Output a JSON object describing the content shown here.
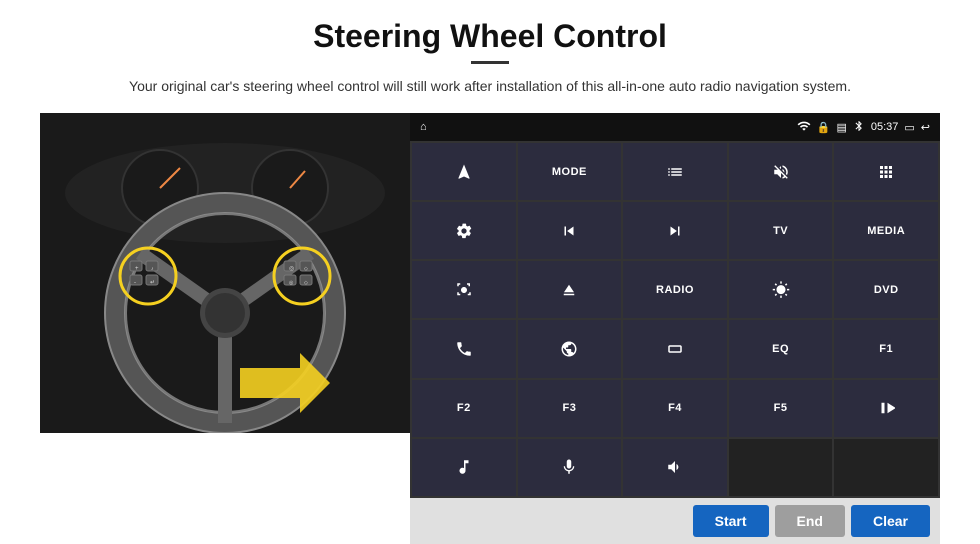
{
  "header": {
    "title": "Steering Wheel Control",
    "subtitle": "Your original car's steering wheel control will still work after installation of this all-in-one auto radio navigation system.",
    "divider": true
  },
  "status_bar": {
    "home_icon": "⌂",
    "wifi_icon": "wifi",
    "lock_icon": "lock",
    "sim_icon": "sim",
    "bt_icon": "bt",
    "time": "05:37",
    "screen_icon": "screen",
    "back_icon": "back"
  },
  "button_rows": [
    [
      {
        "label": "nav",
        "type": "icon"
      },
      {
        "label": "MODE",
        "type": "text"
      },
      {
        "label": "list",
        "type": "icon"
      },
      {
        "label": "mute",
        "type": "icon"
      },
      {
        "label": "apps",
        "type": "icon"
      }
    ],
    [
      {
        "label": "settings",
        "type": "icon"
      },
      {
        "label": "prev",
        "type": "icon"
      },
      {
        "label": "next",
        "type": "icon"
      },
      {
        "label": "TV",
        "type": "text"
      },
      {
        "label": "MEDIA",
        "type": "text"
      }
    ],
    [
      {
        "label": "360cam",
        "type": "icon"
      },
      {
        "label": "eject",
        "type": "icon"
      },
      {
        "label": "RADIO",
        "type": "text"
      },
      {
        "label": "brightness",
        "type": "icon"
      },
      {
        "label": "DVD",
        "type": "text"
      }
    ],
    [
      {
        "label": "phone",
        "type": "icon"
      },
      {
        "label": "internet",
        "type": "icon"
      },
      {
        "label": "aspect",
        "type": "icon"
      },
      {
        "label": "EQ",
        "type": "text"
      },
      {
        "label": "F1",
        "type": "text"
      }
    ],
    [
      {
        "label": "F2",
        "type": "text"
      },
      {
        "label": "F3",
        "type": "text"
      },
      {
        "label": "F4",
        "type": "text"
      },
      {
        "label": "F5",
        "type": "text"
      },
      {
        "label": "play-pause",
        "type": "icon"
      }
    ],
    [
      {
        "label": "music",
        "type": "icon"
      },
      {
        "label": "mic",
        "type": "icon"
      },
      {
        "label": "vol-phone",
        "type": "icon"
      },
      {
        "label": "",
        "type": "empty"
      },
      {
        "label": "",
        "type": "empty"
      }
    ]
  ],
  "bottom_bar": {
    "start_label": "Start",
    "end_label": "End",
    "clear_label": "Clear"
  }
}
